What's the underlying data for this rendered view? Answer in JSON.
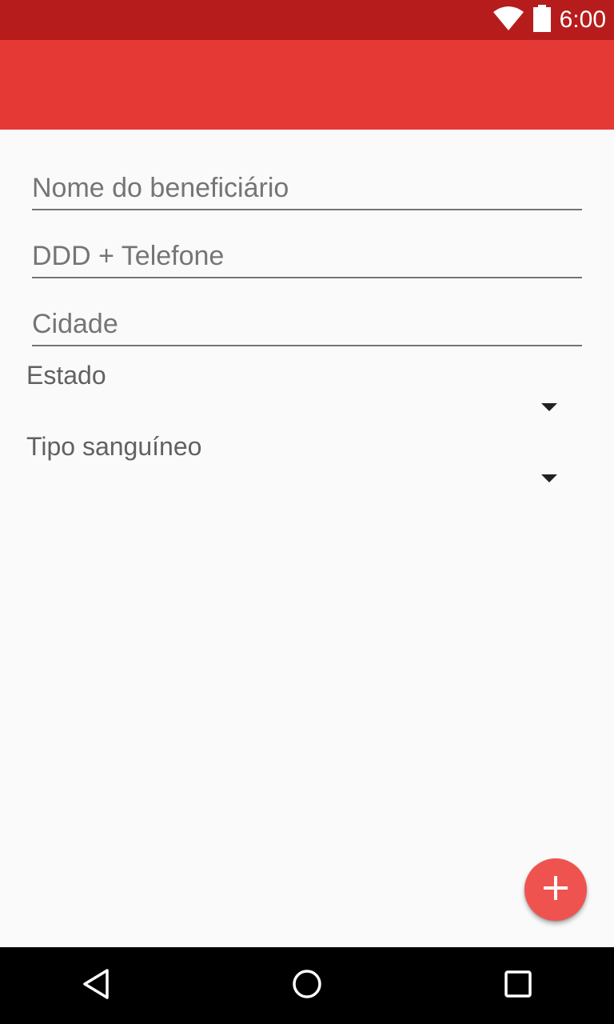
{
  "status_bar": {
    "time": "6:00",
    "icons": [
      "wifi-icon",
      "battery-icon"
    ],
    "color": "#b71c1c"
  },
  "app_bar": {
    "color": "#e53935"
  },
  "form": {
    "name_placeholder": "Nome do beneficiário",
    "name_value": "",
    "phone_placeholder": "DDD + Telefone",
    "phone_value": "",
    "city_placeholder": "Cidade",
    "city_value": "",
    "state_label": "Estado",
    "state_selected": "",
    "blood_type_label": "Tipo sanguíneo",
    "blood_type_selected": ""
  },
  "fab": {
    "icon": "plus-icon",
    "color": "#ef5350"
  },
  "nav_bar": {
    "icons": [
      "back-icon",
      "home-icon",
      "recents-icon"
    ]
  }
}
